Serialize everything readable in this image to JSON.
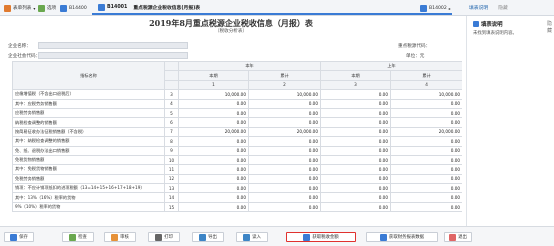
{
  "toolbar": {
    "items": [
      {
        "label": "表单列表",
        "icon": "list-icon"
      },
      {
        "label": "选项",
        "icon": "options-icon"
      },
      {
        "label": "B14400",
        "icon": "back-icon"
      },
      {
        "label": "B14001",
        "icon": "form-icon"
      }
    ],
    "active_tab": "重点税源企业税收信息(月报)表",
    "right_tab": "B14002",
    "panel_tabs": [
      "填表说明",
      "隐藏"
    ]
  },
  "form": {
    "title": "2019年8月重点税源企业税收信息（月报）表",
    "subtitle": "（税收分析表）",
    "meta": {
      "taxpayer_name_label": "企业名称：",
      "taxpayer_id_label": "企业社会代码：",
      "industry_label": "重点税源代码：",
      "unit_label": "单位：元"
    },
    "header": {
      "indicator": "指标名称",
      "line_no": "行次",
      "current_year": "本年",
      "last_year": "上年",
      "current_period": "本期",
      "cumulative": "累计",
      "col_nums": [
        "1",
        "2",
        "3",
        "4"
      ]
    },
    "rows": [
      {
        "line": "3",
        "name": "应缴增值税（不含出口退税后）",
        "indent": false,
        "v": [
          "10,000.00",
          "10,000.00",
          "0.00",
          "10,000.00"
        ]
      },
      {
        "line": "4",
        "name": "其中：应税劳务销售额",
        "indent": true,
        "v": [
          "0.00",
          "0.00",
          "0.00",
          "0.00"
        ]
      },
      {
        "line": "5",
        "name": "应税劳务销售额",
        "indent": true,
        "v": [
          "0.00",
          "0.00",
          "0.00",
          "0.00"
        ]
      },
      {
        "line": "6",
        "name": "纳税检查调整的销售额",
        "indent": true,
        "v": [
          "0.00",
          "0.00",
          "0.00",
          "0.00"
        ]
      },
      {
        "line": "7",
        "name": "按简易征收办法征税销售额（不含税）",
        "indent": false,
        "v": [
          "20,000.00",
          "20,000.00",
          "0.00",
          "20,000.00"
        ]
      },
      {
        "line": "8",
        "name": "其中：纳税检查调整的销售额",
        "indent": true,
        "v": [
          "0.00",
          "0.00",
          "0.00",
          "0.00"
        ]
      },
      {
        "line": "9",
        "name": "免、抵、退税办法出口销售额",
        "indent": false,
        "v": [
          "0.00",
          "0.00",
          "0.00",
          "0.00"
        ]
      },
      {
        "line": "10",
        "name": "免税货物销售额",
        "indent": false,
        "v": [
          "0.00",
          "0.00",
          "0.00",
          "0.00"
        ]
      },
      {
        "line": "11",
        "name": "其中：免税货物销售额",
        "indent": true,
        "v": [
          "0.00",
          "0.00",
          "0.00",
          "0.00"
        ]
      },
      {
        "line": "12",
        "name": "免税劳务销售额",
        "indent": true,
        "v": [
          "0.00",
          "0.00",
          "0.00",
          "0.00"
        ]
      },
      {
        "line": "13",
        "name": "销项：不应计销项抵扣的进项税额（13=14+15+16+17+18+19）",
        "indent": true,
        "v": [
          "0.00",
          "0.00",
          "0.00",
          "0.00"
        ]
      },
      {
        "line": "14",
        "name": "其中：13%（16%）税率的货物",
        "indent": true,
        "v": [
          "0.00",
          "0.00",
          "0.00",
          "0.00"
        ]
      },
      {
        "line": "15",
        "name": "9%（10%）税率的货物",
        "indent": true,
        "v": [
          "0.00",
          "0.00",
          "0.00",
          "0.00"
        ]
      }
    ]
  },
  "help": {
    "title": "填表说明",
    "close": "隐藏",
    "text": "未找到填表说明内容。"
  },
  "bottom": {
    "buttons": [
      {
        "label": "保存",
        "icon": "save-icon"
      },
      {
        "label": "检查",
        "icon": "check-icon"
      },
      {
        "label": "审核",
        "icon": "audit-icon"
      },
      {
        "label": "打印",
        "icon": "print-icon"
      },
      {
        "label": "导出",
        "icon": "export-icon"
      },
      {
        "label": "读入",
        "icon": "import-icon"
      },
      {
        "label": "获取税收金额",
        "icon": "fetch-icon"
      },
      {
        "label": "获取财务报表数据",
        "icon": "fetch-finance-icon"
      },
      {
        "label": "退出",
        "icon": "exit-icon"
      }
    ]
  },
  "colors": {
    "accent": "#3a7bd5",
    "highlight_border": "#e0322f"
  }
}
